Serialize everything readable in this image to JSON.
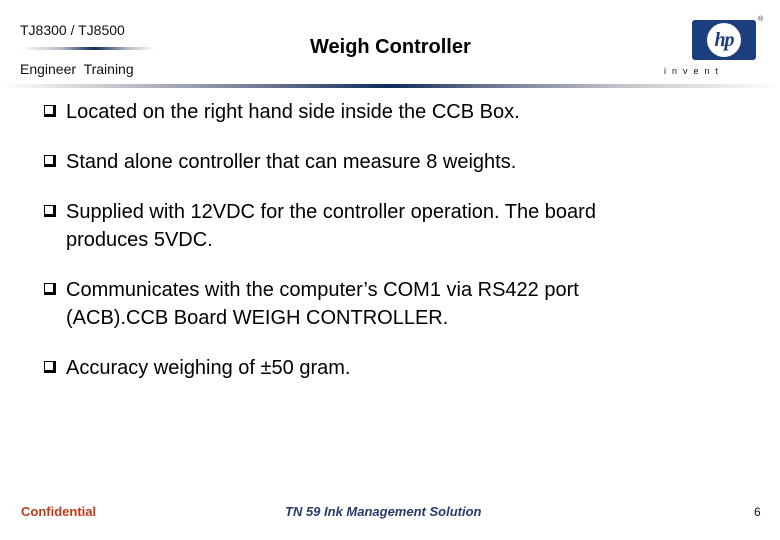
{
  "header": {
    "product": "TJ8300 / TJ8500",
    "subtitle": "Engineer  Training",
    "title": "Weigh Controller",
    "logo": {
      "mark": "hp",
      "tagline": "invent",
      "registered": "®",
      "brand_color": "#1b3f7d"
    }
  },
  "bullets": [
    {
      "lines": [
        "Located on the right hand side inside the CCB Box."
      ]
    },
    {
      "lines": [
        "Stand alone controller that can measure 8 weights."
      ]
    },
    {
      "lines": [
        "Supplied with 12VDC for the controller operation. The board",
        "produces 5VDC."
      ]
    },
    {
      "lines": [
        "Communicates with the computer’s COM1 via RS422 port",
        "(ACB).CCB Board WEIGH CONTROLLER."
      ]
    },
    {
      "lines": [
        "Accuracy weighing of ±50 gram."
      ]
    }
  ],
  "footer": {
    "left": "Confidential",
    "center": "TN 59 Ink Management Solution",
    "page_number": "6",
    "left_color": "#c03a1a",
    "center_color": "#2a3a6a"
  }
}
